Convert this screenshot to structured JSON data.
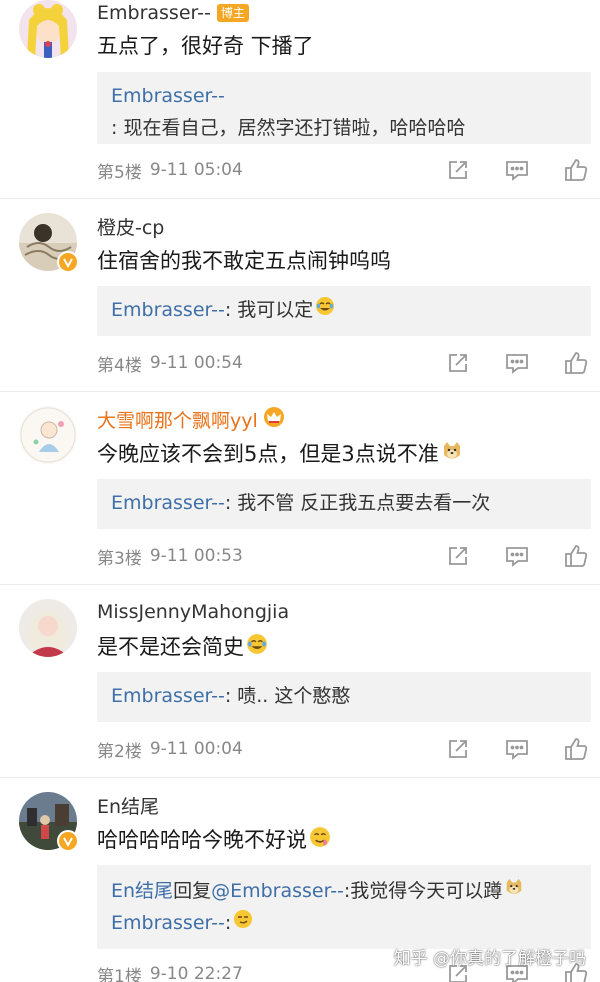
{
  "comments": [
    {
      "username": "Embrasser--",
      "badge": "博主",
      "text": "五点了，很好奇 下播了",
      "replies": [
        {
          "author": "Embrasser--",
          "text": ": 现在看自己，居然字还打错啦，哈哈哈哈"
        }
      ],
      "floor": "第5楼",
      "time": "9-11 05:04"
    },
    {
      "username": "橙皮-cp",
      "text": "住宿舍的我不敢定五点闹钟呜呜",
      "replies": [
        {
          "author": "Embrasser--",
          "text": ": 我可以定"
        }
      ],
      "floor": "第4楼",
      "time": "9-11 00:54"
    },
    {
      "username": "大雪啊那个飘啊yyl",
      "text": "今晚应该不会到5点，但是3点说不准",
      "replies": [
        {
          "author": "Embrasser--",
          "text": ": 我不管 反正我五点要去看一次"
        }
      ],
      "floor": "第3楼",
      "time": "9-11 00:53"
    },
    {
      "username": "MissJennyMahongjia",
      "text": "是不是还会简史",
      "replies": [
        {
          "author": "Embrasser--",
          "text": ": 啧.. 这个憨憨"
        }
      ],
      "floor": "第2楼",
      "time": "9-11 00:04"
    },
    {
      "username": "En结尾",
      "text": "哈哈哈哈哈今晚不好说",
      "replies": [
        {
          "author": "En结尾",
          "reply_word": "回复",
          "target": "@Embrasser--",
          "text": ":我觉得今天可以蹲"
        },
        {
          "author": "Embrasser--",
          "text": ": "
        }
      ],
      "floor": "第1楼",
      "time": "9-10 22:27"
    }
  ],
  "watermark": "知乎 @你真的了解橙子吗",
  "colors": {
    "link": "#3e6fa8",
    "vip_name": "#e8731a",
    "badge": "#f5a623",
    "meta": "#888888",
    "reply_bg": "#f2f2f2"
  },
  "icons": {
    "actions": [
      "share-icon",
      "comment-icon",
      "like-icon"
    ]
  }
}
